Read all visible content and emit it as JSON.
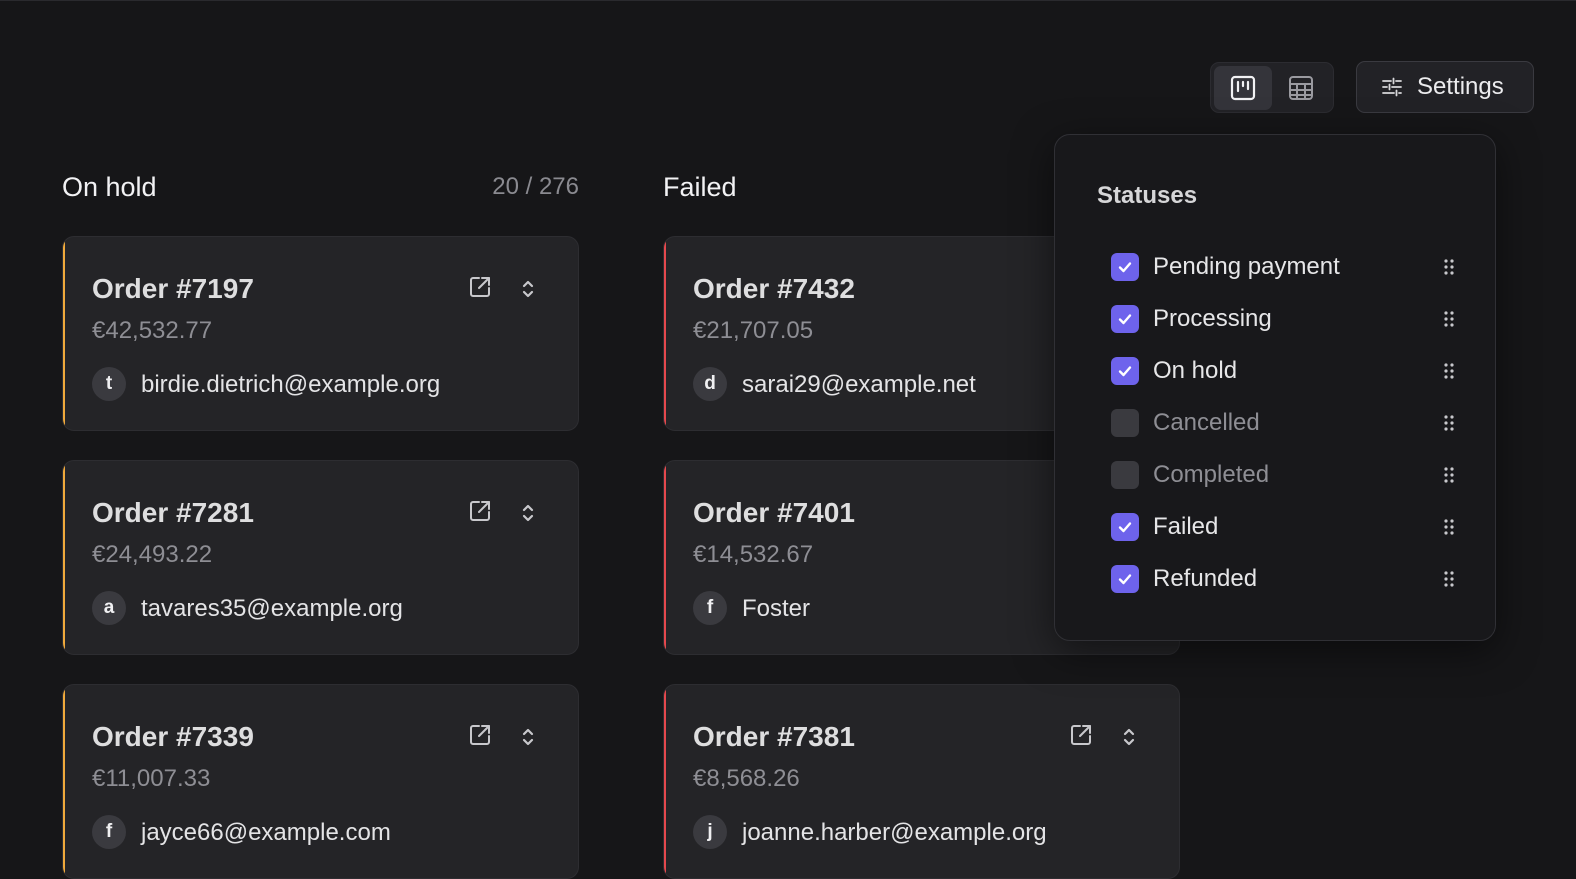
{
  "toolbar": {
    "settings_label": "Settings",
    "views": [
      {
        "icon": "kanban-icon",
        "active": true
      },
      {
        "icon": "table-icon",
        "active": false
      }
    ]
  },
  "columns": [
    {
      "title": "On hold",
      "count": "20 / 276",
      "accent": "#f0a93b",
      "cards": [
        {
          "title": "Order #7197",
          "amount": "€42,532.77",
          "avatar": "t",
          "customer": "birdie.dietrich@example.org"
        },
        {
          "title": "Order #7281",
          "amount": "€24,493.22",
          "avatar": "a",
          "customer": "tavares35@example.org"
        },
        {
          "title": "Order #7339",
          "amount": "€11,007.33",
          "avatar": "f",
          "customer": "jayce66@example.com"
        }
      ]
    },
    {
      "title": "Failed",
      "count": "",
      "accent": "#e5484d",
      "cards": [
        {
          "title": "Order #7432",
          "amount": "€21,707.05",
          "avatar": "d",
          "customer": "sarai29@example.net"
        },
        {
          "title": "Order #7401",
          "amount": "€14,532.67",
          "avatar": "f",
          "customer": "Foster"
        },
        {
          "title": "Order #7381",
          "amount": "€8,568.26",
          "avatar": "j",
          "customer": "joanne.harber@example.org"
        }
      ]
    }
  ],
  "settings_panel": {
    "title": "Statuses",
    "accent_color": "#6e63ec",
    "statuses": [
      {
        "label": "Pending payment",
        "checked": true
      },
      {
        "label": "Processing",
        "checked": true
      },
      {
        "label": "On hold",
        "checked": true
      },
      {
        "label": "Cancelled",
        "checked": false
      },
      {
        "label": "Completed",
        "checked": false
      },
      {
        "label": "Failed",
        "checked": true
      },
      {
        "label": "Refunded",
        "checked": true
      }
    ]
  }
}
